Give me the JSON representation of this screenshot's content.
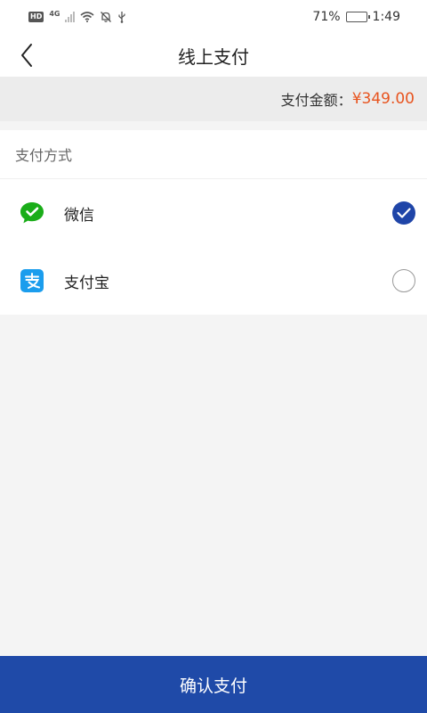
{
  "status_bar": {
    "hd": "HD",
    "network": "4G",
    "battery_percent": "71%",
    "battery_level": 0.71,
    "time": "1:49"
  },
  "nav": {
    "title": "线上支付"
  },
  "payment": {
    "amount_label": "支付金额：",
    "amount_value": "¥349.00"
  },
  "methods": {
    "section_title": "支付方式",
    "items": [
      {
        "label": "微信",
        "icon": "wechat-icon",
        "selected": true
      },
      {
        "label": "支付宝",
        "icon": "alipay-icon",
        "selected": false
      }
    ]
  },
  "footer": {
    "confirm_label": "确认支付"
  },
  "colors": {
    "primary": "#1f4aa8",
    "amount": "#e8541f",
    "wechat": "#1aad19",
    "alipay": "#1b9ded"
  }
}
